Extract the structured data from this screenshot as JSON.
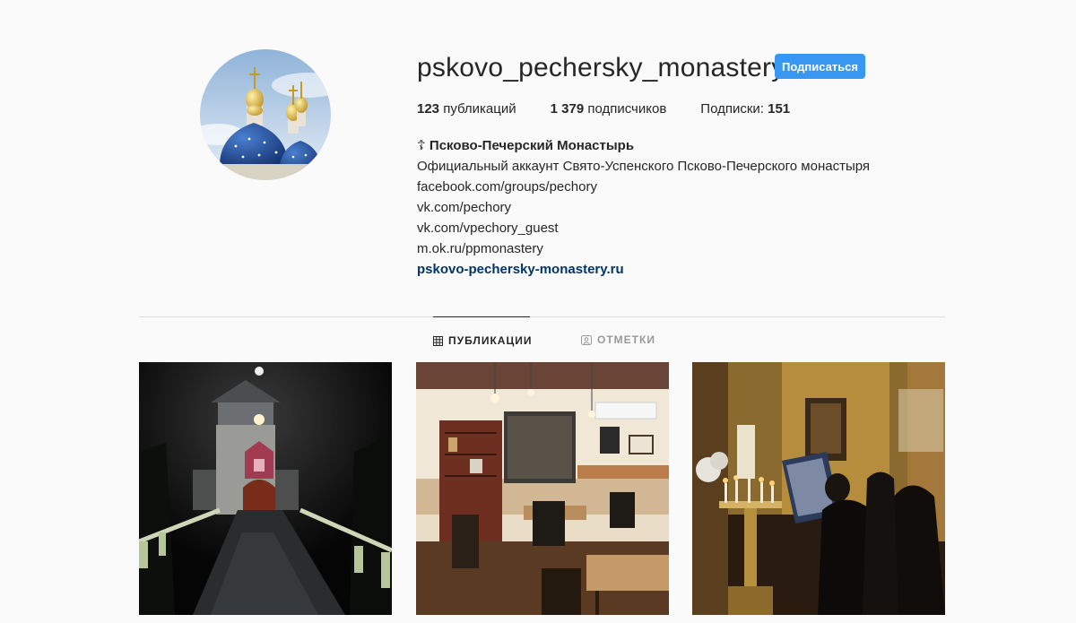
{
  "profile": {
    "username": "pskovo_pechersky_monastery",
    "follow_label": "Подписаться",
    "avatar_alt": "avatar"
  },
  "stats": {
    "posts_count": "123",
    "posts_label": " публикаций",
    "followers_count": "1 379",
    "followers_label": " подписчиков",
    "following_label": "Подписки: ",
    "following_count": "151"
  },
  "bio": {
    "name": "☦ Псково-Печерский Монастырь",
    "lines": [
      "Официальный аккаунт Свято-Успенского Псково-Печерского монастыря",
      "facebook.com/groups/pechory",
      "vk.com/pechory",
      "vk.com/vpechory_guest",
      "m.ok.ru/ppmonastery"
    ],
    "website": "pskovo-pechersky-monastery.ru"
  },
  "tabs": [
    {
      "label": "ПУБЛИКАЦИИ",
      "icon": "grid-icon",
      "active": true
    },
    {
      "label": "ОТМЕТКИ",
      "icon": "tag-user-icon",
      "active": false
    }
  ],
  "colors": {
    "accent": "#3897f0",
    "link": "#003569",
    "background": "#fafafa"
  }
}
